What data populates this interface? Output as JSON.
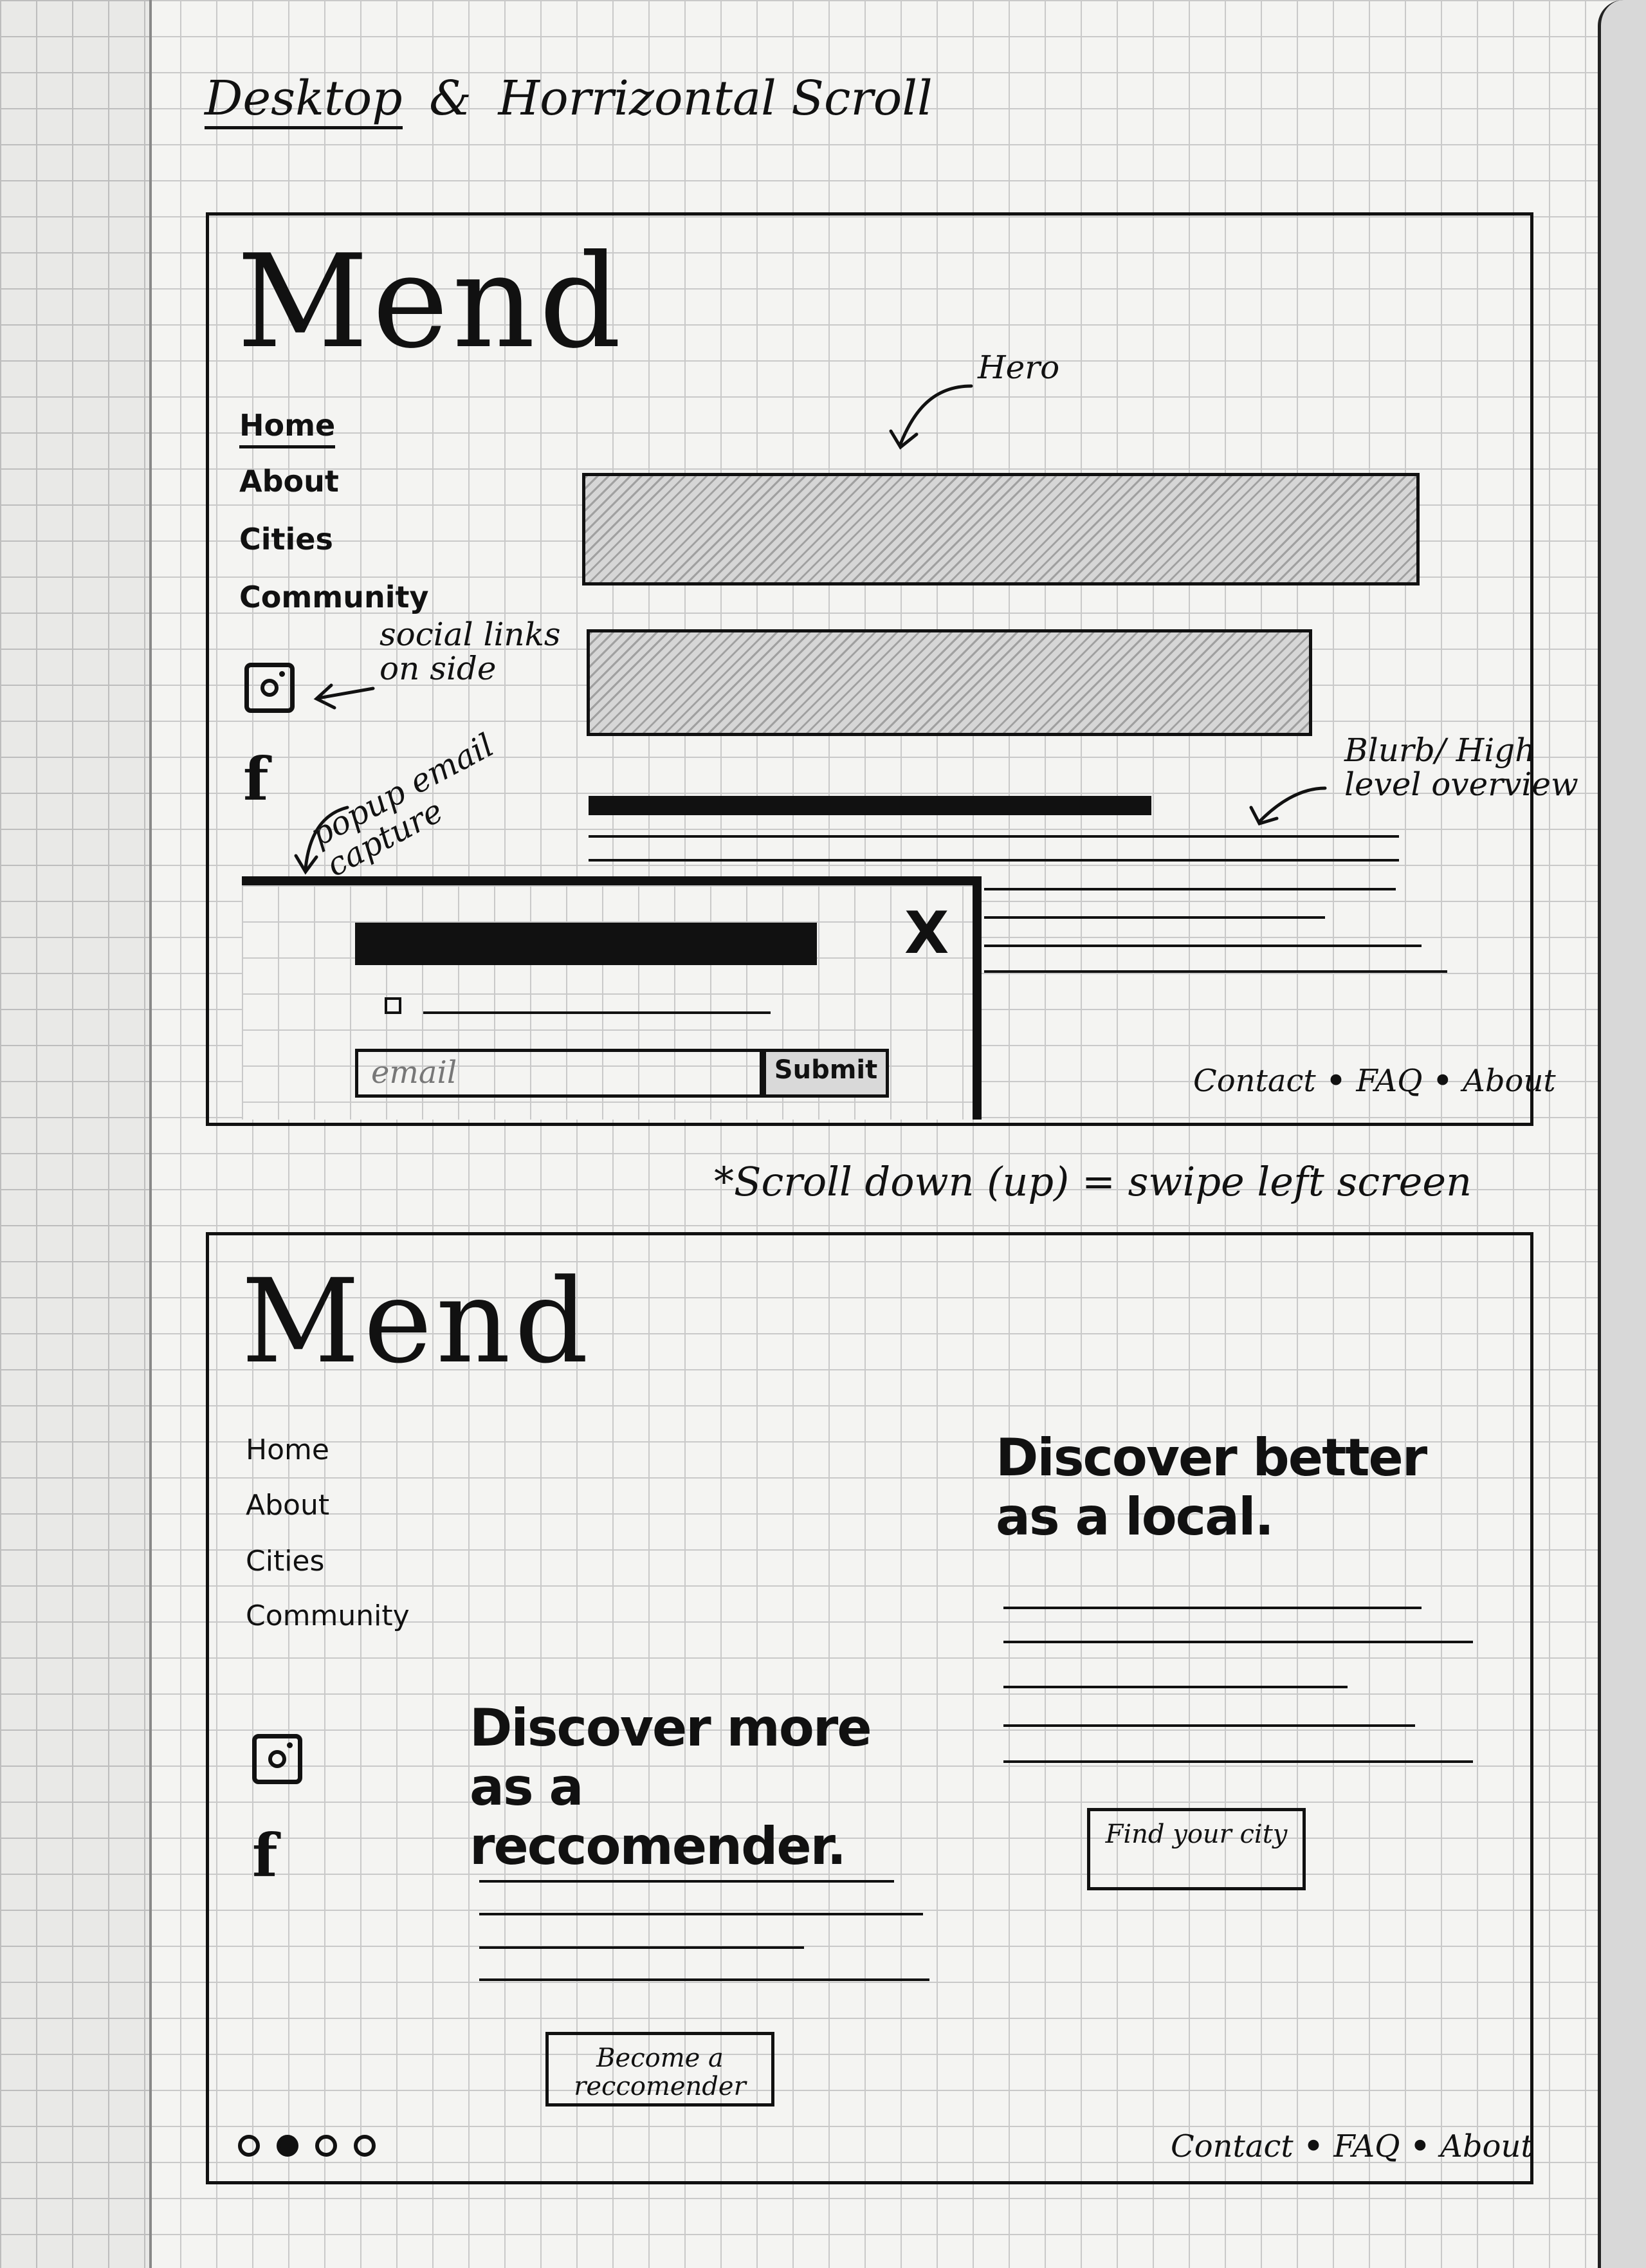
{
  "sketch_title": {
    "part1": "Desktop",
    "amp": "&",
    "part2": "Horrizontal Scroll"
  },
  "screen1": {
    "logo": "Mend",
    "nav": [
      "Home",
      "About",
      "Cities",
      "Community"
    ],
    "annotations": {
      "hero": "Hero",
      "social": "social links on side",
      "popup": "popup email capture",
      "blurb": "Blurb/ High level overview"
    },
    "popup": {
      "close": "X",
      "email_placeholder": "email",
      "submit_label": "Submit"
    },
    "footer": {
      "contact": "Contact",
      "faq": "FAQ",
      "about": "About",
      "sep": "•"
    }
  },
  "scroll_note": "*Scroll down (up) = swipe left screen",
  "screen2": {
    "logo": "Mend",
    "nav": [
      "Home",
      "About",
      "Cities",
      "Community"
    ],
    "recommender": {
      "headline": "Discover more as a reccomender.",
      "button": "Become a reccomender"
    },
    "local": {
      "headline": "Discover better as a local.",
      "button": "Find your city"
    },
    "pager": {
      "count": 4,
      "active_index": 1
    },
    "footer": {
      "contact": "Contact",
      "faq": "FAQ",
      "about": "About",
      "sep": "•"
    }
  }
}
